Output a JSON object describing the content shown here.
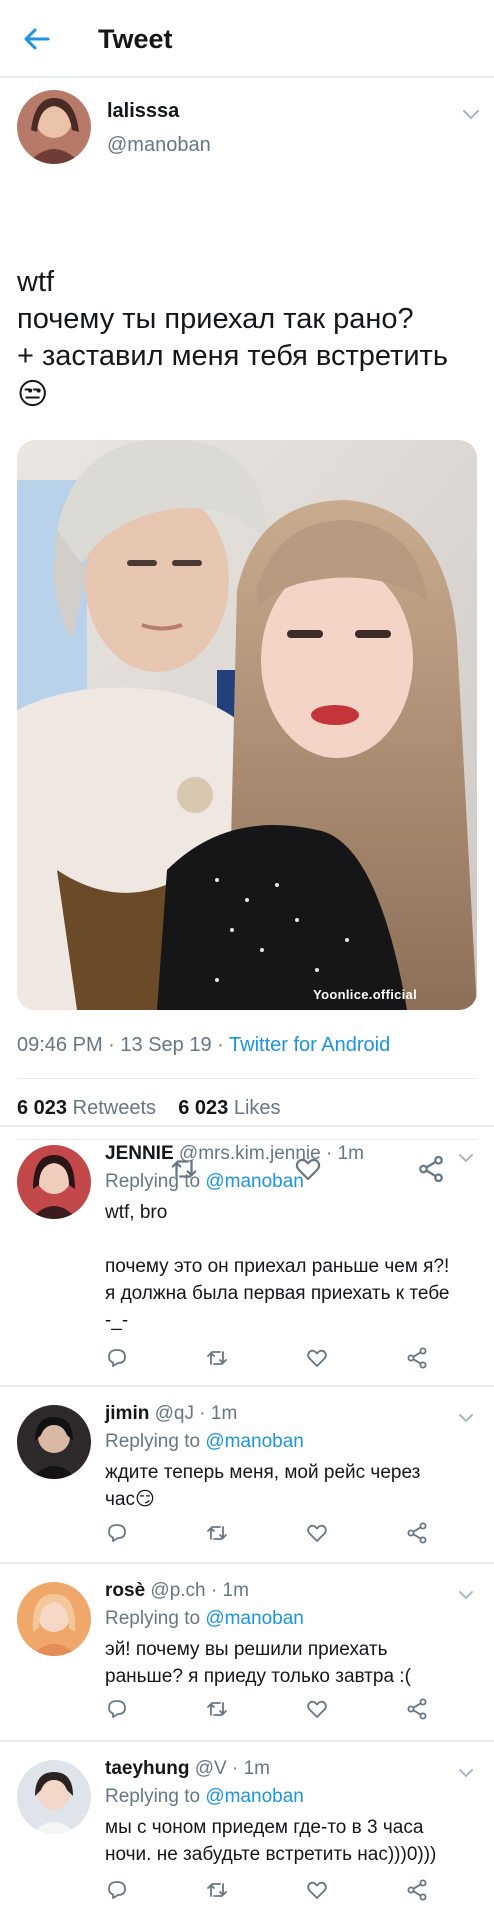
{
  "header": {
    "title": "Tweet",
    "back_icon": "arrow-left-icon",
    "accent": "#1b95e0"
  },
  "tweet": {
    "author_name": "lalisssa",
    "author_handle": "@manoban",
    "text_lines": [
      "wtf",
      "почему ты приехал так рано?",
      "+ заставил меня тебя встретить"
    ],
    "emoji": "😒",
    "image_watermark": "Yoonlice.official",
    "time": "09:46 PM",
    "date": "13 Sep 19",
    "source": "Twitter for Android",
    "separator": " · ",
    "retweets_count": "6 023",
    "retweets_label": "Retweets",
    "likes_count": "6 023",
    "likes_label": "Likes"
  },
  "replies": [
    {
      "name": "JENNIE",
      "handle": "@mrs.kim.jennie",
      "time": "1m",
      "replying_prefix": "Replying to",
      "replying_to": "@manoban",
      "lines": [
        "wtf, bro",
        "",
        "почему это он приехал раньше чем я?!",
        "я должна была первая приехать к тебе",
        "-_-"
      ]
    },
    {
      "name": "jimin",
      "handle": "@qJ",
      "time": "1m",
      "replying_prefix": "Replying to",
      "replying_to": "@manoban",
      "lines": [
        "ждите теперь меня, мой рейс через",
        "час😏"
      ]
    },
    {
      "name": "rosè",
      "handle": "@p.ch",
      "time": "1m",
      "replying_prefix": "Replying to",
      "replying_to": "@manoban",
      "lines": [
        "эй! почему вы решили приехать",
        "раньше? я приеду только завтра :("
      ]
    },
    {
      "name": "taeyhung",
      "handle": "@V",
      "time": "1m",
      "replying_prefix": "Replying to",
      "replying_to": "@manoban",
      "lines": [
        "мы с чоном приедем где-то в 3 часа",
        "ночи. не забудьте встретить нас)))0)))"
      ]
    }
  ],
  "action_icons": [
    "reply-icon",
    "retweet-icon",
    "like-icon",
    "share-icon"
  ]
}
